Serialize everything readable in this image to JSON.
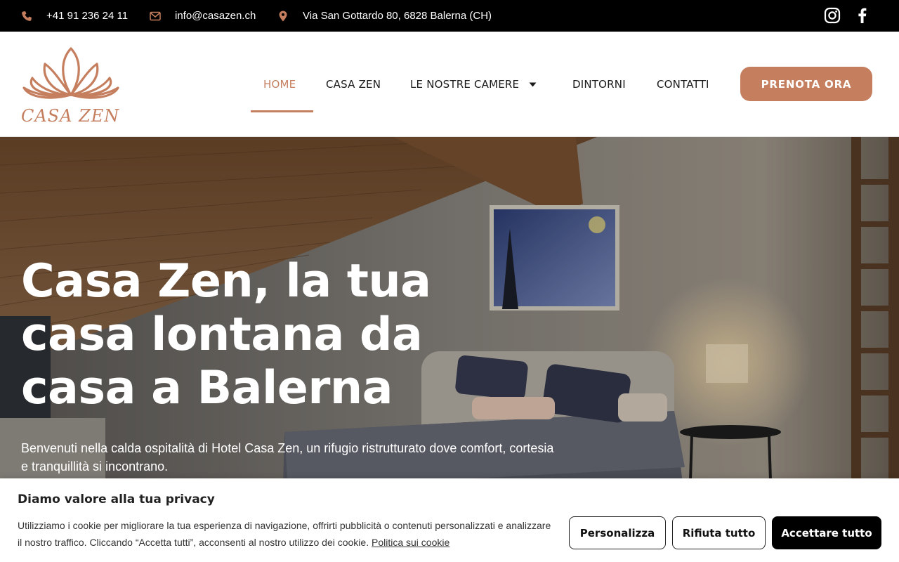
{
  "colors": {
    "accent": "#c57f5f",
    "topbar_bg": "#000000"
  },
  "topbar": {
    "phone": "+41 91 236 24 11",
    "email": "info@casazen.ch",
    "address": "Via San Gottardo 80, 6828 Balerna (CH)",
    "icons": [
      "phone-icon",
      "envelope-icon",
      "map-marker-icon",
      "instagram-icon",
      "facebook-icon"
    ]
  },
  "header": {
    "logo_text": "CASA ZEN",
    "nav": [
      {
        "label": "HOME",
        "active": true
      },
      {
        "label": "CASA ZEN"
      },
      {
        "label": "LE NOSTRE CAMERE",
        "dropdown": true
      },
      {
        "label": "DINTORNI"
      },
      {
        "label": "CONTATTI"
      }
    ],
    "cta_label": "PRENOTA ORA"
  },
  "hero": {
    "title": "Casa Zen, la tua casa lontana da casa a Balerna",
    "subtitle": "Benvenuti nella calda ospitalità di Hotel Casa Zen, un rifugio ristrutturato dove comfort, cortesia e tranquillità si incontrano."
  },
  "cookie": {
    "title": "Diamo valore alla tua privacy",
    "text": "Utilizziamo i cookie per migliorare la tua esperienza di navigazione, offrirti pubblicità o contenuti personalizzati e analizzare il nostro traffico. Cliccando “Accetta tutti”, acconsenti al nostro utilizzo dei cookie.",
    "policy_link": "Politica sui cookie",
    "buttons": {
      "customize": "Personalizza",
      "reject": "Rifiuta tutto",
      "accept": "Accettare tutto"
    }
  }
}
